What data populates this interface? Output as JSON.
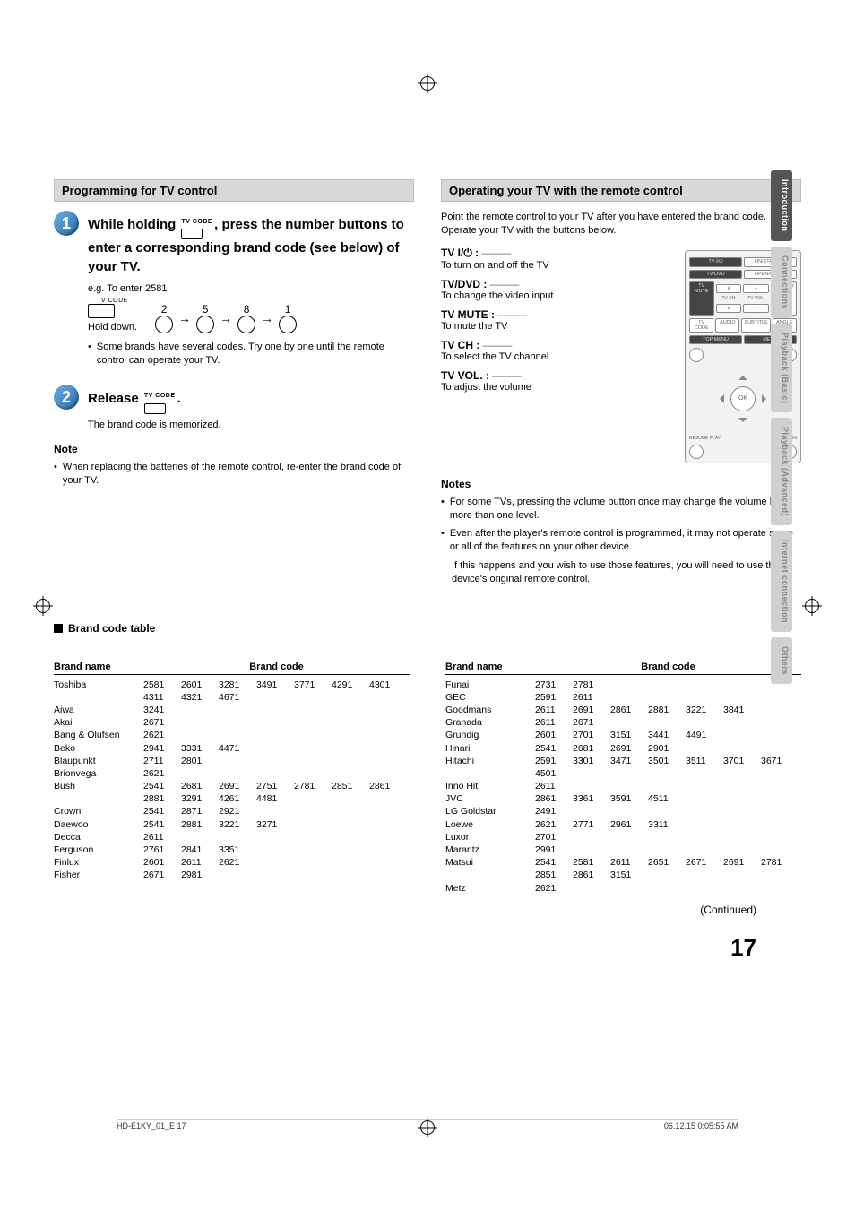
{
  "side_tabs": {
    "items": [
      {
        "label": "Introduction",
        "active": true
      },
      {
        "label": "Connections",
        "active": false
      },
      {
        "label": "Playback (Basic)",
        "active": false
      },
      {
        "label": "Playback (Advanced)",
        "active": false
      },
      {
        "label": "Internet connection",
        "active": false
      },
      {
        "label": "Others",
        "active": false
      }
    ]
  },
  "left": {
    "section_title": "Programming for TV control",
    "step1": {
      "num": "1",
      "title_a": "While holding ",
      "title_b": ", press the number buttons to enter a corresponding brand code (see below) of your TV.",
      "tvcode": "TV CODE",
      "example": "e.g. To enter 2581",
      "digits": [
        "2",
        "5",
        "8",
        "1"
      ],
      "hold": "Hold down.",
      "bullet": "Some brands have several codes. Try one by one until the remote control can operate your TV."
    },
    "step2": {
      "num": "2",
      "title_a": "Release ",
      "title_b": ".",
      "tvcode": "TV CODE",
      "note": "The brand code is memorized."
    },
    "note_hd": "Note",
    "note_txt": "When replacing the batteries of the remote control, re-enter the brand code of your TV."
  },
  "right": {
    "section_title": "Operating your TV with the remote control",
    "intro": "Point the remote control to your TV after you have entered the brand code. Operate your TV with the buttons below.",
    "ops": [
      {
        "label": "TV I/⏻ :",
        "desc": "To turn on and off the TV"
      },
      {
        "label": "TV/DVD :",
        "desc": "To change the video input"
      },
      {
        "label": "TV MUTE :",
        "desc": "To mute the TV"
      },
      {
        "label": "TV CH :",
        "desc": "To select the TV channel"
      },
      {
        "label": "TV VOL. :",
        "desc": "To adjust the volume"
      }
    ],
    "remote": {
      "row1": [
        "TV I/⏻",
        "ON/STANDBY"
      ],
      "row2": [
        "TV/DVD",
        "OPEN/CLOSE"
      ],
      "row3": [
        "TV MUTE",
        "∧",
        "TV CH",
        "+",
        "TV VOL.",
        "DISPLAY"
      ],
      "row3b": [
        "",
        "∨",
        "",
        "−",
        "",
        ""
      ],
      "row4": [
        "TV CODE",
        "AUDIO",
        "SUBTITLE",
        "ANGLE"
      ],
      "row5": [
        "TOP MENU",
        "MENU"
      ],
      "ok": "OK",
      "bottom": [
        "RESUME PLAY",
        "RETURN"
      ]
    },
    "notes_hd": "Notes",
    "notes": [
      "For some TVs, pressing the volume button once may change the volume by more than one level.",
      "Even after the player's remote control is programmed, it may not operate some or all of the features on your other device.",
      "If this happens and you wish to use those features, you will need to use the device's original remote control."
    ]
  },
  "codes": {
    "title": "Brand code table",
    "hd_name": "Brand name",
    "hd_code": "Brand code",
    "left": [
      {
        "name": "Toshiba",
        "codes": [
          "2581",
          "2601",
          "3281",
          "3491",
          "3771",
          "4291",
          "4301",
          "4311",
          "4321",
          "4671"
        ]
      },
      {
        "name": "Aiwa",
        "codes": [
          "3241"
        ]
      },
      {
        "name": "Akai",
        "codes": [
          "2671"
        ]
      },
      {
        "name": "Bang & Olufsen",
        "codes": [
          "2621"
        ]
      },
      {
        "name": "Beko",
        "codes": [
          "2941",
          "3331",
          "4471"
        ]
      },
      {
        "name": "Blaupunkt",
        "codes": [
          "2711",
          "2801"
        ]
      },
      {
        "name": "Brionvega",
        "codes": [
          "2621"
        ]
      },
      {
        "name": "Bush",
        "codes": [
          "2541",
          "2681",
          "2691",
          "2751",
          "2781",
          "2851",
          "2861",
          "2881",
          "3291",
          "4261",
          "4481"
        ]
      },
      {
        "name": "Crown",
        "codes": [
          "2541",
          "2871",
          "2921"
        ]
      },
      {
        "name": "Daewoo",
        "codes": [
          "2541",
          "2881",
          "3221",
          "3271"
        ]
      },
      {
        "name": "Decca",
        "codes": [
          "2611"
        ]
      },
      {
        "name": "Ferguson",
        "codes": [
          "2761",
          "2841",
          "3351"
        ]
      },
      {
        "name": "Finlux",
        "codes": [
          "2601",
          "2611",
          "2621"
        ]
      },
      {
        "name": "Fisher",
        "codes": [
          "2671",
          "2981"
        ]
      }
    ],
    "right": [
      {
        "name": "Funai",
        "codes": [
          "2731",
          "2781"
        ]
      },
      {
        "name": "GEC",
        "codes": [
          "2591",
          "2611"
        ]
      },
      {
        "name": "Goodmans",
        "codes": [
          "2611",
          "2691",
          "2861",
          "2881",
          "3221",
          "3841"
        ]
      },
      {
        "name": "Granada",
        "codes": [
          "2611",
          "2671"
        ]
      },
      {
        "name": "Grundig",
        "codes": [
          "2601",
          "2701",
          "3151",
          "3441",
          "4491"
        ]
      },
      {
        "name": "Hinari",
        "codes": [
          "2541",
          "2681",
          "2691",
          "2901"
        ]
      },
      {
        "name": "Hitachi",
        "codes": [
          "2591",
          "3301",
          "3471",
          "3501",
          "3511",
          "3701",
          "3671",
          "4501"
        ]
      },
      {
        "name": "Inno Hit",
        "codes": [
          "2611"
        ]
      },
      {
        "name": "JVC",
        "codes": [
          "2861",
          "3361",
          "3591",
          "4511"
        ]
      },
      {
        "name": "LG Goldstar",
        "codes": [
          "2491"
        ]
      },
      {
        "name": "Loewe",
        "codes": [
          "2621",
          "2771",
          "2961",
          "3311"
        ]
      },
      {
        "name": "Luxor",
        "codes": [
          "2701"
        ]
      },
      {
        "name": "Marantz",
        "codes": [
          "2991"
        ]
      },
      {
        "name": "Matsui",
        "codes": [
          "2541",
          "2581",
          "2611",
          "2651",
          "2671",
          "2691",
          "2781",
          "2851",
          "2861",
          "3151"
        ]
      },
      {
        "name": "Metz",
        "codes": [
          "2621"
        ]
      }
    ]
  },
  "continued": "(Continued)",
  "page_number": "17",
  "footer_left": "HD-E1KY_01_E   17",
  "footer_right": "06.12.15   0:05:55 AM"
}
